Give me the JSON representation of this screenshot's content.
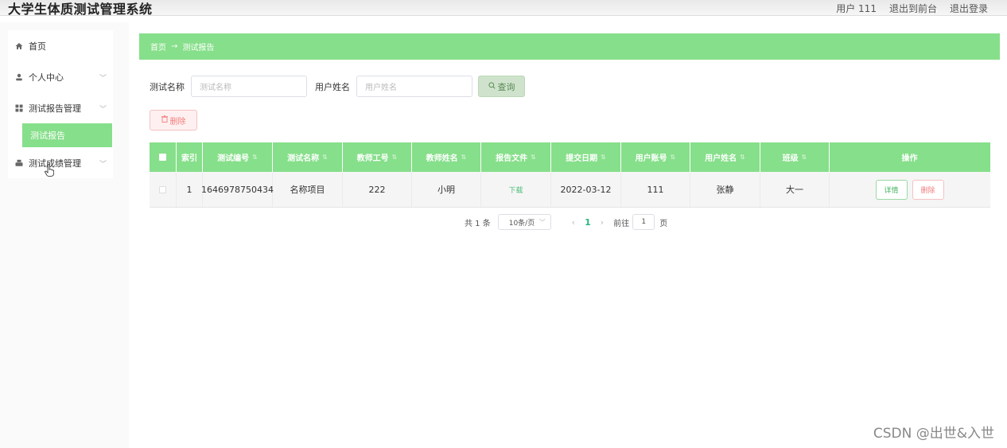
{
  "header": {
    "app_title": "大学生体质测试管理系统",
    "user_label": "用户 111",
    "back_front": "退出到前台",
    "logout": "退出登录"
  },
  "sidebar": {
    "items": [
      {
        "label": "首页",
        "icon": "home-icon"
      },
      {
        "label": "个人中心",
        "icon": "user-icon"
      },
      {
        "label": "测试报告管理",
        "icon": "grid-icon"
      },
      {
        "label": "测试报告",
        "icon": ""
      },
      {
        "label": "测试成绩管理",
        "icon": "print-icon"
      }
    ]
  },
  "breadcrumb": {
    "home": "首页",
    "arrow": "→",
    "current": "测试报告"
  },
  "search": {
    "label1": "测试名称",
    "placeholder1": "测试名称",
    "label2": "用户姓名",
    "placeholder2": "用户姓名",
    "button": "查询"
  },
  "actions": {
    "delete": "删除"
  },
  "table": {
    "headers": [
      "索引",
      "测试编号",
      "测试名称",
      "教师工号",
      "教师姓名",
      "报告文件",
      "提交日期",
      "用户账号",
      "用户姓名",
      "班级",
      "操作"
    ],
    "rows": [
      {
        "index": "1",
        "test_no": "1646978750434",
        "test_name": "名称项目",
        "teacher_no": "222",
        "teacher_name": "小明",
        "file": "下载",
        "date": "2022-03-12",
        "account": "111",
        "user_name": "张静",
        "class": "大一",
        "detail": "详情",
        "delete": "删除"
      }
    ]
  },
  "pagination": {
    "total": "共 1 条",
    "page_size": "10条/页",
    "current": "1",
    "goto_prefix": "前往",
    "goto_value": "1",
    "goto_suffix": "页"
  },
  "watermark": "CSDN @出世&入世",
  "colors": {
    "accent": "#86df8a"
  }
}
